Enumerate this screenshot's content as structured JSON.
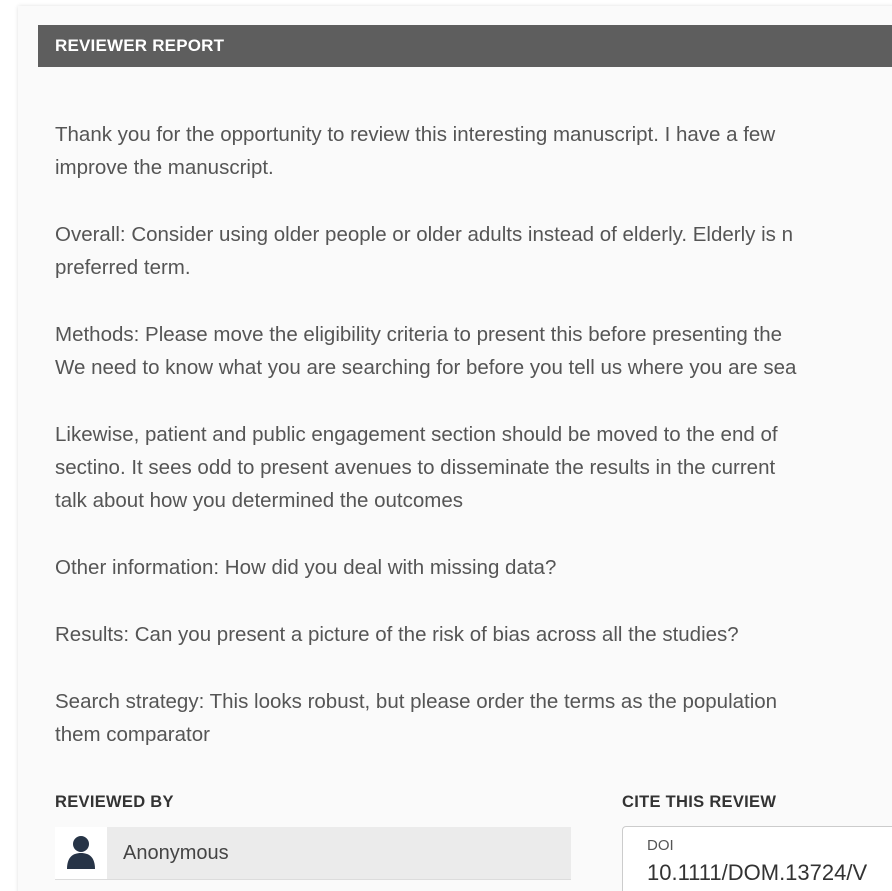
{
  "report": {
    "header_title": "REVIEWER REPORT",
    "paragraphs": [
      "Thank you for the opportunity to review this interesting manuscript. I have a few\nimprove the manuscript.",
      "Overall: Consider using older people or older adults instead of elderly. Elderly is n\npreferred term.",
      "Methods: Please move the eligibility criteria to present this before presenting the\nWe need to know what you are searching for before you tell us where you are sea",
      "Likewise, patient and public engagement section should be moved to the end of\nsectino. It sees odd to present avenues to disseminate the results in the current\ntalk about how you determined the outcomes",
      "Other information: How did you deal with missing data?",
      "Results: Can you present a picture of the risk of bias across all the studies?",
      "Search strategy: This looks robust, but please order the terms as the population\nthem comparator"
    ]
  },
  "reviewed_by": {
    "label": "REVIEWED BY",
    "avatar_icon": "person-icon",
    "name": "Anonymous"
  },
  "cite": {
    "label": "CITE THIS REVIEW",
    "doi_label": "DOI",
    "doi_value": "10.1111/DOM.13724/V"
  },
  "colors": {
    "header_bg": "#5e5e5e",
    "card_bg": "#fafafa",
    "body_text": "#555555"
  }
}
